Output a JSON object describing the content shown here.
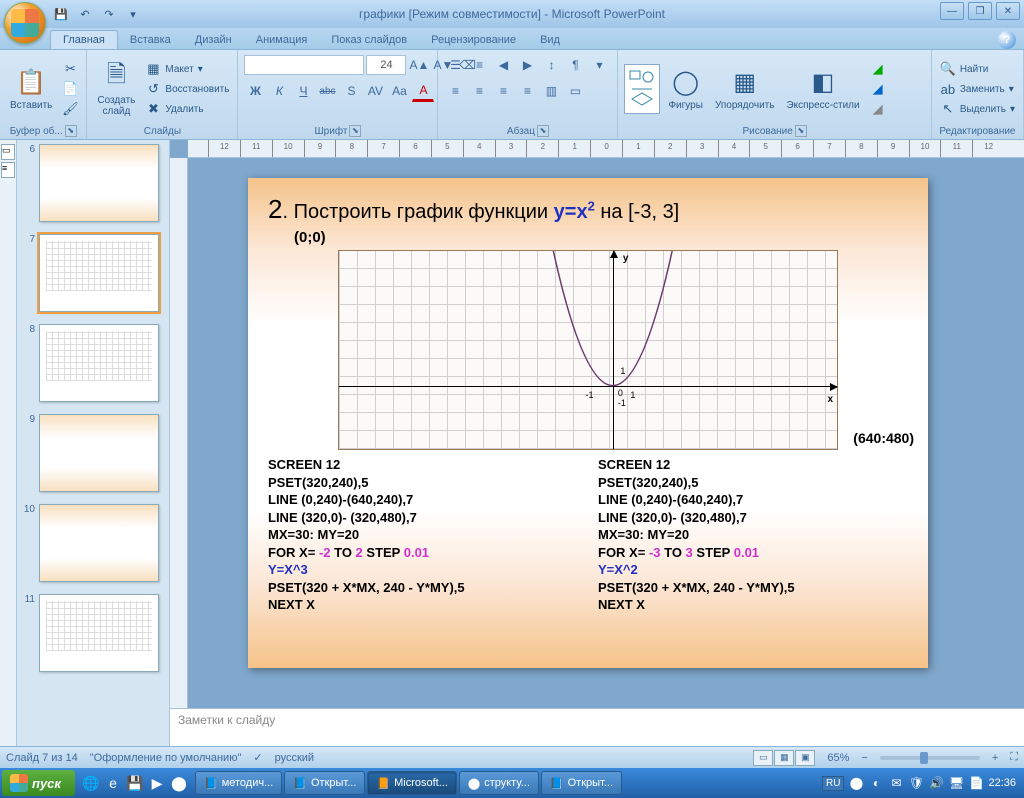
{
  "title": "графики [Режим совместимости] - Microsoft PowerPoint",
  "qat": {
    "save": "💾",
    "undo": "↶",
    "redo": "↷"
  },
  "win": {
    "min": "—",
    "max": "❐",
    "close": "✕"
  },
  "tabs": [
    "Главная",
    "Вставка",
    "Дизайн",
    "Анимация",
    "Показ слайдов",
    "Рецензирование",
    "Вид"
  ],
  "ribbon": {
    "clipboard": {
      "label": "Буфер об...",
      "paste": "Вставить",
      "cut": "✂",
      "copy": "📄",
      "painter": "🖌"
    },
    "slides": {
      "label": "Слайды",
      "new": "Создать\nслайд",
      "layout": "Макет",
      "reset": "Восстановить",
      "delete": "Удалить"
    },
    "font": {
      "label": "Шрифт",
      "size": "24",
      "bold": "Ж",
      "italic": "К",
      "underline": "Ч",
      "strike": "abc",
      "shadow": "S",
      "spacing": "AV",
      "case": "Aa",
      "grow": "A▲",
      "shrink": "A▼",
      "clear": "⌫",
      "color": "A"
    },
    "para": {
      "label": "Абзац",
      "bullets": "≡",
      "numbers": "≡",
      "indent_dec": "≤",
      "indent_inc": "≥",
      "lineheight": "≡",
      "direction": "¶",
      "align_l": "≡",
      "align_c": "≡",
      "align_r": "≡",
      "align_j": "≡",
      "columns": "▥",
      "convert": "▭"
    },
    "draw": {
      "label": "Рисование",
      "shapes": "Фигуры",
      "arrange": "Упорядочить",
      "quick": "Экспресс-стили",
      "fill": "◢",
      "outline": "◢",
      "effects": "◢"
    },
    "edit": {
      "label": "Редактирование",
      "find": "Найти",
      "replace": "Заменить",
      "select": "Выделить"
    }
  },
  "thumbs": [
    6,
    7,
    8,
    9,
    10,
    11
  ],
  "active_thumb": 7,
  "ruler_marks": [
    "12",
    "11",
    "10",
    "9",
    "8",
    "7",
    "6",
    "5",
    "4",
    "3",
    "2",
    "1",
    "0",
    "1",
    "2",
    "3",
    "4",
    "5",
    "6",
    "7",
    "8",
    "9",
    "10",
    "11",
    "12"
  ],
  "slide": {
    "num": "2",
    "title_prefix": ". Построить график функции ",
    "fx": "y=x",
    "exp": "2",
    "title_suffix": " на [-3, 3]",
    "coord00": "(0;0)",
    "coord640": "(640:480)",
    "axis_x": "x",
    "axis_y": "y",
    "ticks": {
      "m1": "-1",
      "p1": "1",
      "p1y": "1",
      "m1y": "-1",
      "zero": "0"
    },
    "code_left": {
      "l1": "SCREEN 12",
      "l2": "PSET(320,240),5",
      "l3": "LINE (0,240)-(640,240),7",
      "l4": "LINE (320,0)- (320,480),7",
      "l5": "MX=30: MY=20",
      "l6a": "FOR X= ",
      "l6b": "-2",
      "l6c": " TO ",
      "l6d": "2",
      "l6e": " STEP ",
      "l6f": "0.01",
      "l7": "Y=X^3",
      "l8": "PSET(320 + X*MX, 240 - Y*MY),5",
      "l9": "NEXT X"
    },
    "code_right": {
      "l1": "SCREEN 12",
      "l2": "PSET(320,240),5",
      "l3": "LINE (0,240)-(640,240),7",
      "l4": "LINE (320,0)- (320,480),7",
      "l5": "MX=30: MY=20",
      "l6a": "FOR X= ",
      "l6b": "-3",
      "l6c": " TO ",
      "l6d": "3",
      "l6e": " STEP ",
      "l6f": "0.01",
      "l7": "Y=X^2",
      "l8": "PSET(320 + X*MX, 240 - Y*MY),5",
      "l9": "NEXT X"
    }
  },
  "notes_placeholder": "Заметки к слайду",
  "status": {
    "slide": "Слайд 7 из 14",
    "theme": "\"Оформление по умолчанию\"",
    "lang": "русский",
    "zoom": "65%"
  },
  "taskbar": {
    "start": "пуск",
    "tasks": [
      "методич...",
      "Открыт...",
      "Microsoft...",
      "структу...",
      "Открыт..."
    ],
    "active_task": 2,
    "lang": "RU",
    "time": "22:36"
  }
}
